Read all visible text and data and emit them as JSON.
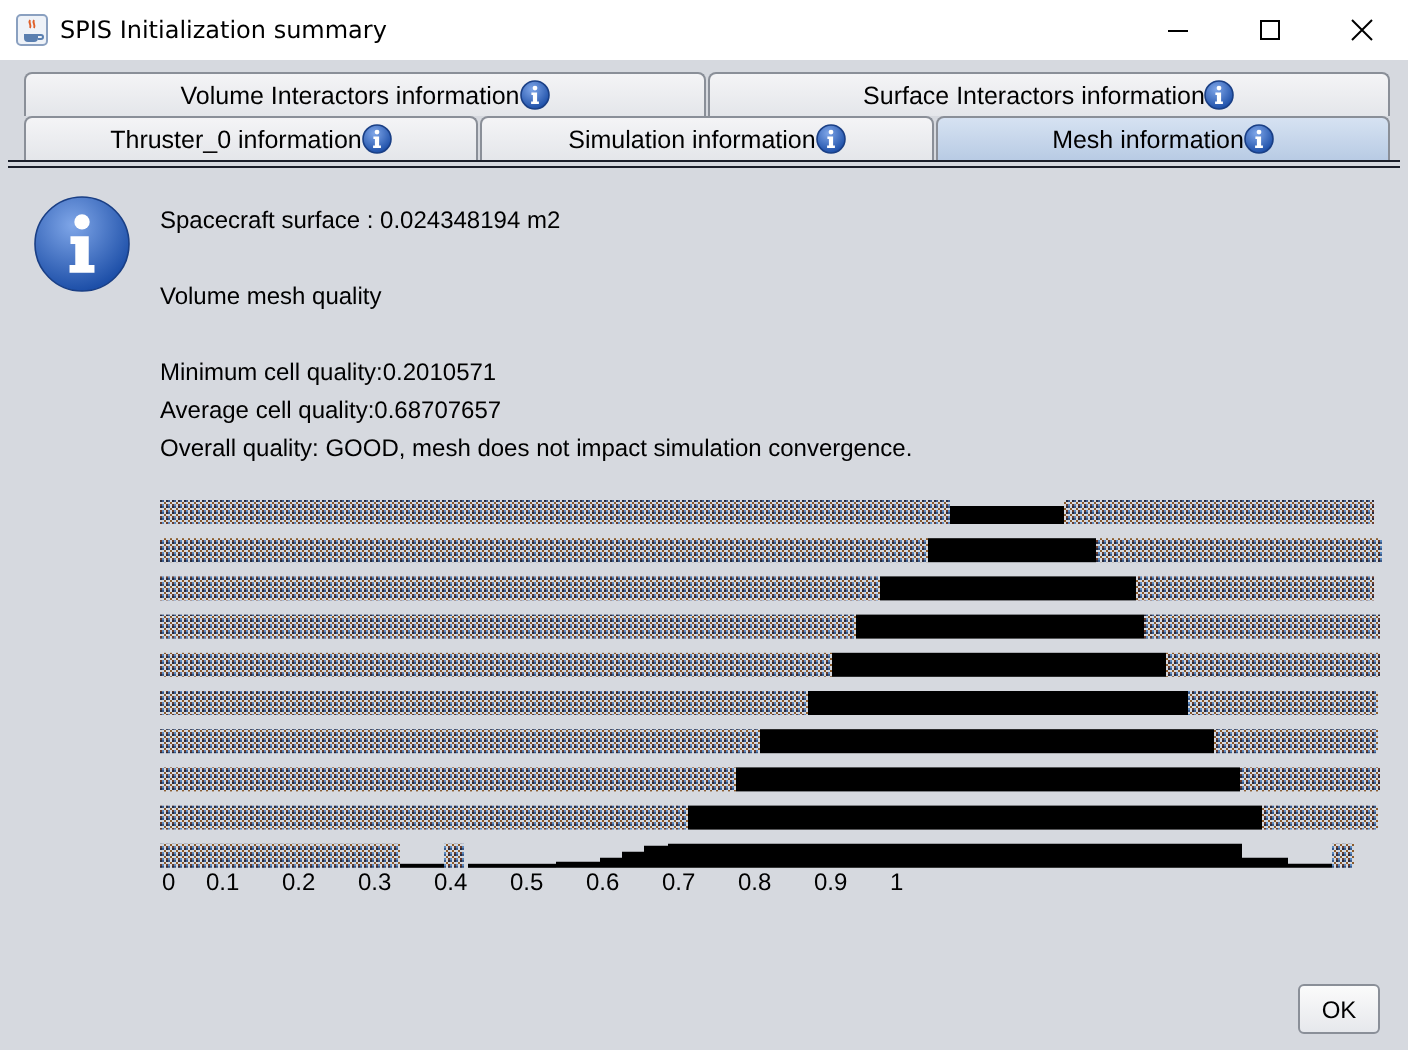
{
  "window": {
    "title": "SPIS Initialization summary"
  },
  "tab_rows": [
    [
      {
        "label": "Volume Interactors information",
        "selected": false
      },
      {
        "label": "Surface Interactors information",
        "selected": false
      }
    ],
    [
      {
        "label": "Thruster_0 information",
        "selected": false
      },
      {
        "label": "Simulation information",
        "selected": false
      },
      {
        "label": "Mesh information",
        "selected": true
      }
    ]
  ],
  "message": {
    "paragraphs": [
      [
        "Spacecraft surface : 0.024348194 m2"
      ],
      [
        "Volume mesh quality"
      ],
      [
        "Minimum cell quality:0.2010571",
        "Average cell quality:0.68707657",
        "Overall quality: GOOD, mesh does not impact simulation convergence."
      ]
    ]
  },
  "histogram": {
    "axis_labels": [
      "0",
      "0.1",
      "0.2",
      "0.3",
      "0.4",
      "0.5",
      "0.6",
      "0.7",
      "0.8",
      "0.9",
      "1"
    ]
  },
  "buttons": [
    "OK"
  ]
}
